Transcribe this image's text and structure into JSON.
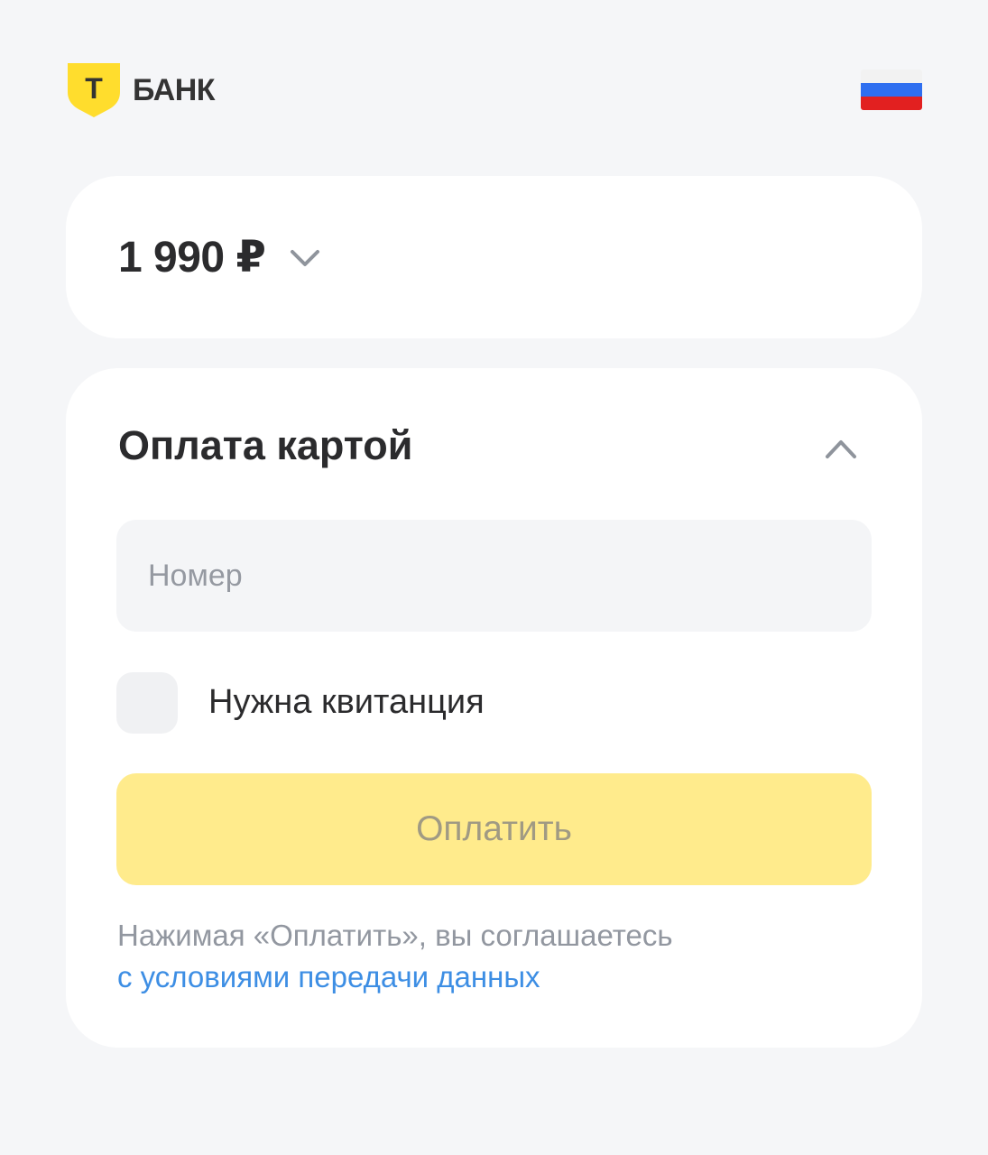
{
  "header": {
    "logo_letter": "Т",
    "logo_text": "БАНК",
    "language_flag": "russia-flag-icon",
    "flag_colors": [
      "#ffffff",
      "#2f6ff0",
      "#e22020"
    ]
  },
  "amount": {
    "value": "1 990 ₽",
    "expand_icon": "chevron-down-icon"
  },
  "payment": {
    "title": "Оплата картой",
    "collapse_icon": "chevron-up-icon",
    "card_number_placeholder": "Номер",
    "card_number_value": "",
    "receipt_label": "Нужна квитанция",
    "receipt_checked": false,
    "pay_button_label": "Оплатить",
    "terms_text": "Нажимая «Оплатить», вы соглашаетесь",
    "terms_link": "с условиями передачи данных"
  },
  "colors": {
    "brand_yellow": "#ffdd2d",
    "button_disabled": "#ffeb8c",
    "link": "#3d8ee4",
    "background": "#f5f6f8"
  }
}
